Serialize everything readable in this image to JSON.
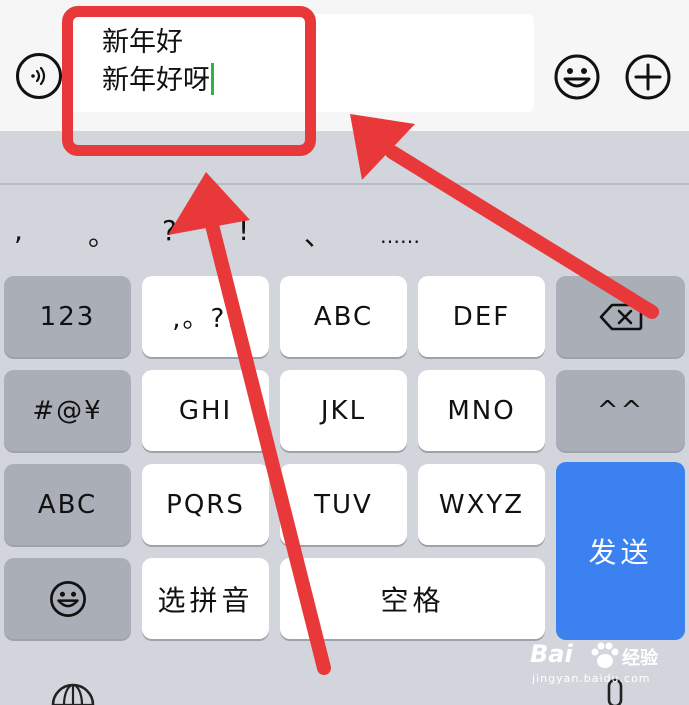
{
  "input": {
    "line1": "新年好",
    "line2": "新年好呀"
  },
  "icons": {
    "voice": "voice-icon",
    "emoji": "emoji-icon",
    "plus": "plus-icon",
    "backspace": "backspace-icon",
    "globe": "globe-icon",
    "mic": "microphone-icon"
  },
  "candidates": [
    ",",
    "。",
    "?",
    "!",
    "、",
    "……"
  ],
  "keys": {
    "row1": [
      "123",
      ",。?!",
      "ABC",
      "DEF"
    ],
    "row2": [
      "#@¥",
      "GHI",
      "JKL",
      "MNO",
      "^^"
    ],
    "row3": [
      "ABC",
      "PQRS",
      "TUV",
      "WXYZ"
    ],
    "row4": [
      "选拼音",
      "空格"
    ],
    "send": "发送"
  },
  "watermark": {
    "brand": "Bai",
    "brand_cn": "经验",
    "url": "jingyan.baidu.com"
  },
  "colors": {
    "annotation_red": "#e8383a",
    "send_blue": "#3b82f0",
    "caret_green": "#2db34a"
  }
}
